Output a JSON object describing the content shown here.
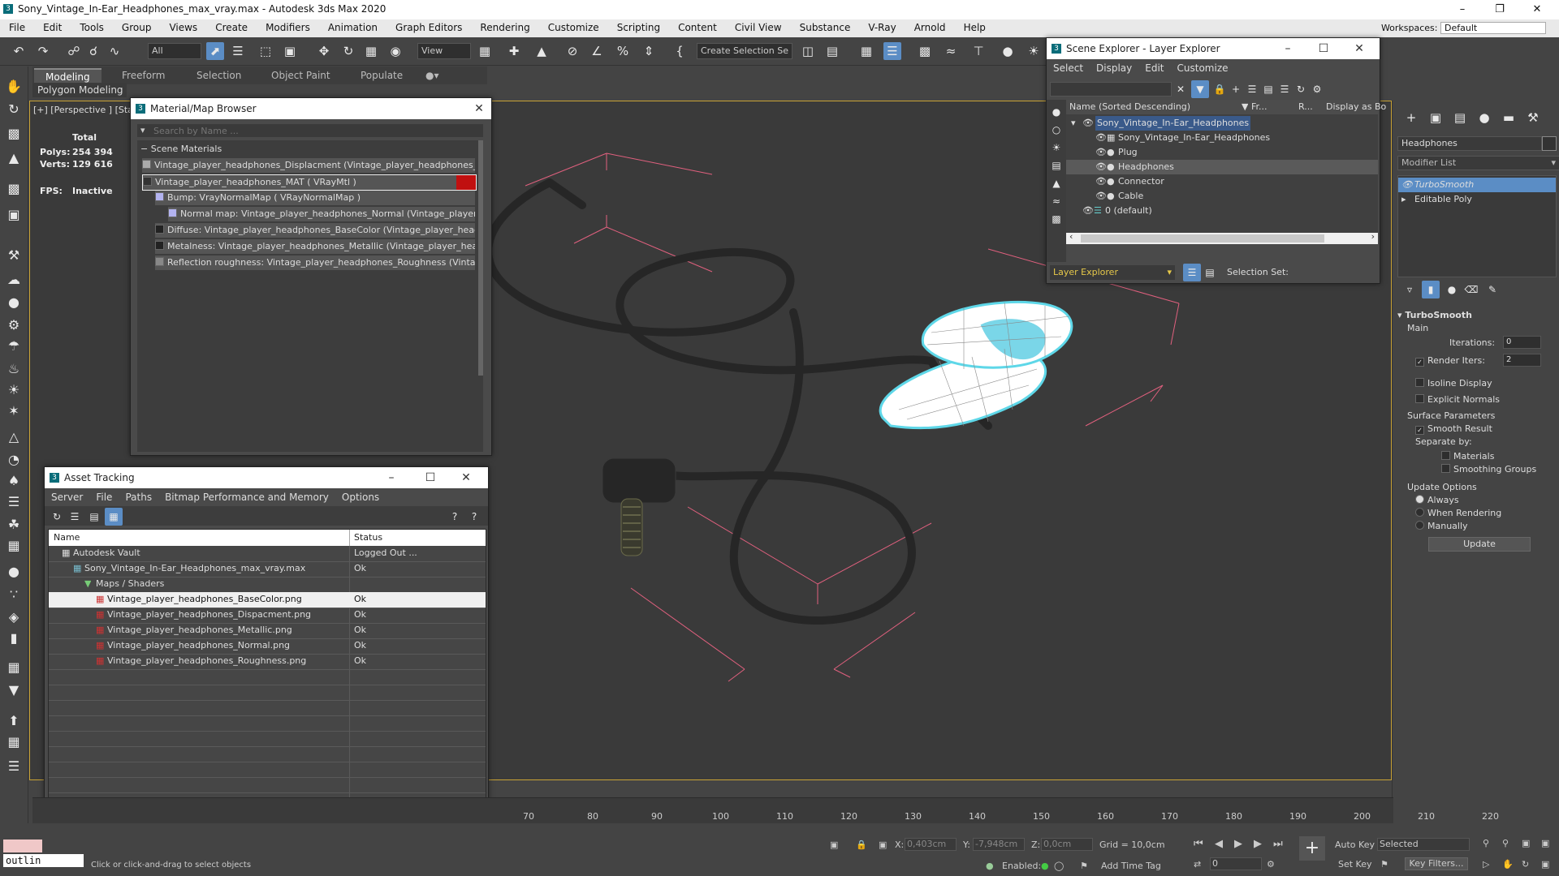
{
  "app": {
    "title": "Sony_Vintage_In-Ear_Headphones_max_vray.max - Autodesk 3ds Max 2020",
    "icon_letter": "3",
    "menu": [
      "File",
      "Edit",
      "Tools",
      "Group",
      "Views",
      "Create",
      "Modifiers",
      "Animation",
      "Graph Editors",
      "Rendering",
      "Customize",
      "Scripting",
      "Content",
      "Civil View",
      "Substance",
      "V-Ray",
      "Arnold",
      "Help"
    ],
    "workspace_label": "Workspaces:",
    "workspace_value": "Default"
  },
  "toolbar": {
    "filter_value": "All",
    "view_value": "View",
    "selection_set_value": "Create Selection Se"
  },
  "ribbon": {
    "tabs": [
      "Modeling",
      "Freeform",
      "Selection",
      "Object Paint",
      "Populate"
    ],
    "sub_label": "Polygon Modeling"
  },
  "viewport": {
    "label": "[+] [Perspective ] [Stan",
    "total_label": "Total",
    "polys_label": "Polys:",
    "polys_value": "254 394",
    "verts_label": "Verts:",
    "verts_value": "129 616",
    "fps_label": "FPS:",
    "fps_value": "Inactive"
  },
  "material_browser": {
    "title": "Material/Map Browser",
    "search_placeholder": "Search by Name ...",
    "group_label": "Scene Materials",
    "items": [
      "Vintage_player_headphones_Displacment (Vintage_player_headphones_Dis...",
      "Vintage_player_headphones_MAT  ( VRayMtl )",
      "Bump: VrayNormalMap  ( VRayNormalMap )",
      "Normal map: Vintage_player_headphones_Normal (Vintage_player_h...",
      "Diffuse: Vintage_player_headphones_BaseColor (Vintage_player_headph...",
      "Metalness: Vintage_player_headphones_Metallic (Vintage_player_headp...",
      "Reflection roughness: Vintage_player_headphones_Roughness (Vintage_..."
    ]
  },
  "asset_tracking": {
    "title": "Asset Tracking",
    "menu": [
      "Server",
      "File",
      "Paths",
      "Bitmap Performance and Memory",
      "Options"
    ],
    "col_name": "Name",
    "col_status": "Status",
    "rows": [
      {
        "name": "Autodesk Vault",
        "status": "Logged Out ..."
      },
      {
        "name": "Sony_Vintage_In-Ear_Headphones_max_vray.max",
        "status": "Ok"
      },
      {
        "name": "Maps / Shaders",
        "status": ""
      },
      {
        "name": "Vintage_player_headphones_BaseColor.png",
        "status": "Ok"
      },
      {
        "name": "Vintage_player_headphones_Dispacment.png",
        "status": "Ok"
      },
      {
        "name": "Vintage_player_headphones_Metallic.png",
        "status": "Ok"
      },
      {
        "name": "Vintage_player_headphones_Normal.png",
        "status": "Ok"
      },
      {
        "name": "Vintage_player_headphones_Roughness.png",
        "status": "Ok"
      }
    ]
  },
  "scene_explorer": {
    "title": "Scene Explorer - Layer Explorer",
    "menu": [
      "Select",
      "Display",
      "Edit",
      "Customize"
    ],
    "col_name": "Name (Sorted Descending)",
    "col_fr": "Fr...",
    "col_r": "R...",
    "col_display": "Display as Bo",
    "rows": [
      "Sony_Vintage_In-Ear_Headphones",
      "Sony_Vintage_In-Ear_Headphones",
      "Plug",
      "Headphones",
      "Connector",
      "Cable",
      "0 (default)"
    ],
    "footer_dropdown": "Layer Explorer",
    "selection_set_label": "Selection Set:"
  },
  "command_panel": {
    "object_name": "Headphones",
    "modifier_list": "Modifier List",
    "stack": [
      "TurboSmooth",
      "Editable Poly"
    ],
    "rollout_title": "TurboSmooth",
    "main_label": "Main",
    "iterations_label": "Iterations:",
    "iterations_value": "0",
    "render_iters_label": "Render Iters:",
    "render_iters_value": "2",
    "isoline_label": "Isoline Display",
    "explicit_normals_label": "Explicit Normals",
    "surface_params_label": "Surface Parameters",
    "smooth_result_label": "Smooth Result",
    "separate_by_label": "Separate by:",
    "materials_label": "Materials",
    "smoothing_groups_label": "Smoothing Groups",
    "update_options_label": "Update Options",
    "always_label": "Always",
    "when_rendering_label": "When Rendering",
    "manually_label": "Manually",
    "update_button": "Update"
  },
  "timeline": {
    "ticks": [
      "70",
      "80",
      "90",
      "100",
      "110",
      "120",
      "130",
      "140",
      "150",
      "160",
      "170",
      "180",
      "190",
      "200",
      "210",
      "220"
    ]
  },
  "status": {
    "maxscript_value": "outlin",
    "prompt": "Click or click-and-drag to select objects",
    "x_label": "X:",
    "x_value": "0,403cm",
    "y_label": "Y:",
    "y_value": "-7,948cm",
    "z_label": "Z:",
    "z_value": "0,0cm",
    "grid_label": "Grid = 10,0cm",
    "enabled_label": "Enabled:",
    "add_time_tag": "Add Time Tag",
    "frame_value": "0",
    "auto_key": "Auto Key",
    "set_key": "Set Key",
    "selected_value": "Selected",
    "key_filters": "Key Filters..."
  }
}
